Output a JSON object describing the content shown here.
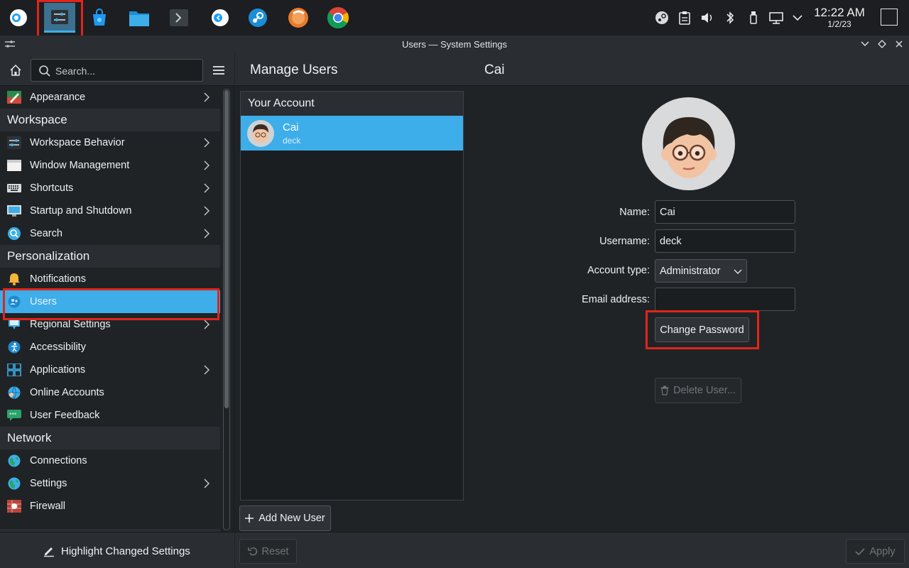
{
  "taskbar": {
    "apps": [
      {
        "name": "steam-deck-menu-icon"
      },
      {
        "name": "system-settings-icon",
        "active": true
      },
      {
        "name": "discover-store-icon"
      },
      {
        "name": "file-manager-icon"
      },
      {
        "name": "terminal-icon"
      },
      {
        "name": "return-to-gaming-mode-icon"
      },
      {
        "name": "steam-icon"
      },
      {
        "name": "protonup-icon"
      },
      {
        "name": "chrome-icon"
      }
    ],
    "tray": [
      "steam-tray-icon",
      "clipboard-icon",
      "volume-icon",
      "bluetooth-icon",
      "usb-icon",
      "display-icon",
      "expand-tray-icon"
    ],
    "clock_time": "12:22 AM",
    "clock_date": "1/2/23"
  },
  "window": {
    "title": "Users — System Settings"
  },
  "sidebar": {
    "search_placeholder": "Search...",
    "items": [
      {
        "type": "item",
        "label": "Appearance",
        "icon": "appearance-icon",
        "chevron": true
      },
      {
        "type": "category",
        "label": "Workspace"
      },
      {
        "type": "item",
        "label": "Workspace Behavior",
        "icon": "workspace-behavior-icon",
        "chevron": true
      },
      {
        "type": "item",
        "label": "Window Management",
        "icon": "window-management-icon",
        "chevron": true
      },
      {
        "type": "item",
        "label": "Shortcuts",
        "icon": "keyboard-icon",
        "chevron": true
      },
      {
        "type": "item",
        "label": "Startup and Shutdown",
        "icon": "startup-icon",
        "chevron": true
      },
      {
        "type": "item",
        "label": "Search",
        "icon": "search-settings-icon",
        "chevron": true
      },
      {
        "type": "category",
        "label": "Personalization"
      },
      {
        "type": "item",
        "label": "Notifications",
        "icon": "bell-icon",
        "chevron": false
      },
      {
        "type": "item",
        "label": "Users",
        "icon": "users-icon",
        "chevron": false,
        "selected": true
      },
      {
        "type": "item",
        "label": "Regional Settings",
        "icon": "regional-icon",
        "chevron": true
      },
      {
        "type": "item",
        "label": "Accessibility",
        "icon": "accessibility-icon",
        "chevron": false
      },
      {
        "type": "item",
        "label": "Applications",
        "icon": "applications-icon",
        "chevron": true
      },
      {
        "type": "item",
        "label": "Online Accounts",
        "icon": "online-accounts-icon",
        "chevron": false
      },
      {
        "type": "item",
        "label": "User Feedback",
        "icon": "feedback-icon",
        "chevron": false
      },
      {
        "type": "category",
        "label": "Network"
      },
      {
        "type": "item",
        "label": "Connections",
        "icon": "globe-icon",
        "chevron": false
      },
      {
        "type": "item",
        "label": "Settings",
        "icon": "globe-icon",
        "chevron": true
      },
      {
        "type": "item",
        "label": "Firewall",
        "icon": "firewall-icon",
        "chevron": false
      }
    ],
    "footer_button": "Highlight Changed Settings"
  },
  "main": {
    "header_title": "Manage Users",
    "user_title": "Cai",
    "your_account_label": "Your Account",
    "user_row": {
      "name": "Cai",
      "sub": "deck"
    },
    "form": {
      "name_label": "Name:",
      "name_value": "Cai",
      "username_label": "Username:",
      "username_value": "deck",
      "account_type_label": "Account type:",
      "account_type_value": "Administrator",
      "email_label": "Email address:",
      "email_value": ""
    },
    "change_password": "Change Password",
    "delete_user": "Delete User...",
    "add_user": "Add New User",
    "reset": "Reset",
    "apply": "Apply"
  },
  "colors": {
    "accent": "#3daee9",
    "highlight_box": "#e0251b"
  }
}
